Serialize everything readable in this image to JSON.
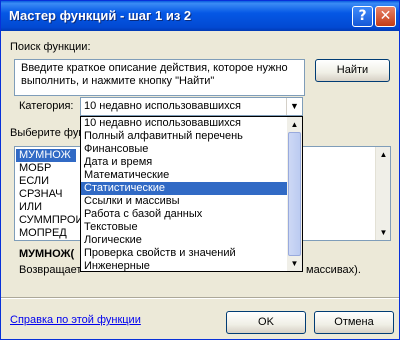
{
  "window": {
    "title": "Мастер функций - шаг 1 из 2",
    "help_btn": "?",
    "close_btn": "✕"
  },
  "search": {
    "label": "Поиск функции:",
    "text_line1": "Введите краткое описание действия, которое нужно",
    "text_line2": "выполнить, и нажмите кнопку \"Найти\"",
    "find_button": "Найти"
  },
  "category": {
    "label": "Категория:",
    "selected": "10 недавно использовавшихся",
    "options": [
      "10 недавно использовавшихся",
      "Полный алфавитный перечень",
      "Финансовые",
      "Дата и время",
      "Математические",
      "Статистические",
      "Ссылки и массивы",
      "Работа с базой данных",
      "Текстовые",
      "Логические",
      "Проверка свойств и значений",
      "Инженерные"
    ],
    "highlighted_index": 5
  },
  "functions": {
    "label": "Выберите фун",
    "items": [
      "МУМНОЖ",
      "МОБР",
      "ЕСЛИ",
      "СРЗНАЧ",
      "ИЛИ",
      "СУММПРОИ",
      "МОПРЕД"
    ],
    "selected_index": 0
  },
  "description": {
    "signature": "МУМНОЖ(",
    "text_start": "Возвращает",
    "text_end": "массивах)."
  },
  "footer": {
    "help_link": "Справка по этой функции",
    "ok": "OK",
    "cancel": "Отмена"
  }
}
